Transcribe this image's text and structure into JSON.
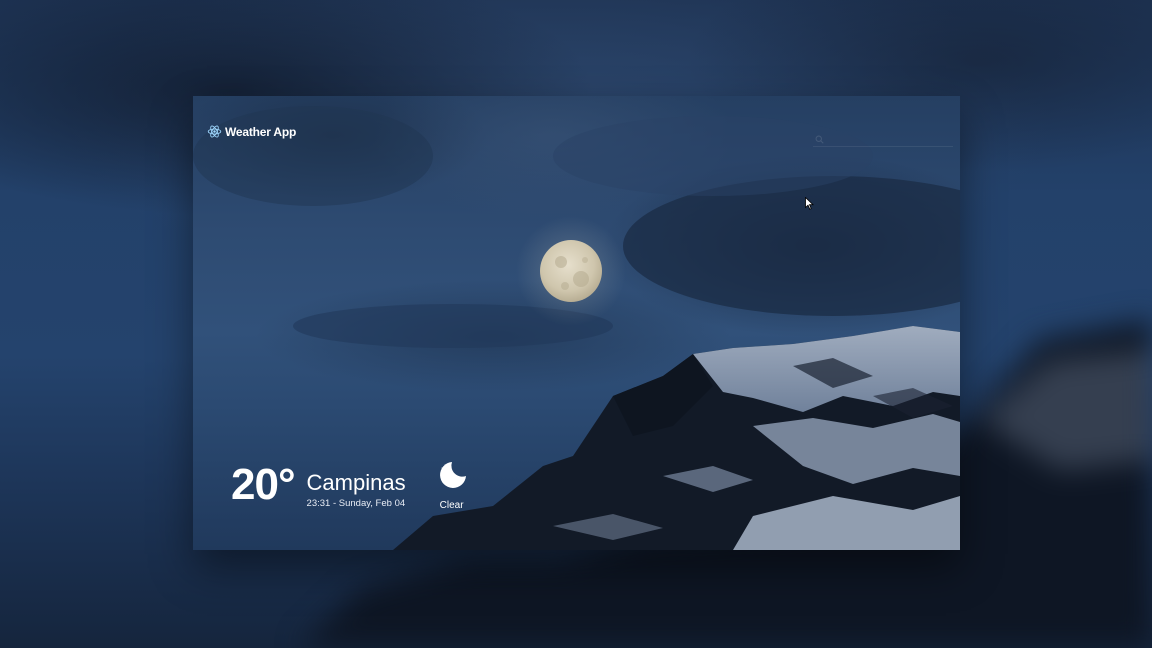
{
  "app": {
    "brand": "Weather App",
    "brand_icon": "react-atom-icon"
  },
  "search": {
    "placeholder": "",
    "value": ""
  },
  "weather": {
    "temperature": "20°",
    "city": "Campinas",
    "datetime": "23:31 - Sunday, Feb 04",
    "condition": "Clear",
    "condition_icon": "moon-stars-icon"
  },
  "colors": {
    "sky_dark": "#1b2d48",
    "sky_mid": "#2e4b72",
    "moon": "#d9d2bf",
    "snow": "#c9d4e4",
    "rock": "#141b28"
  }
}
